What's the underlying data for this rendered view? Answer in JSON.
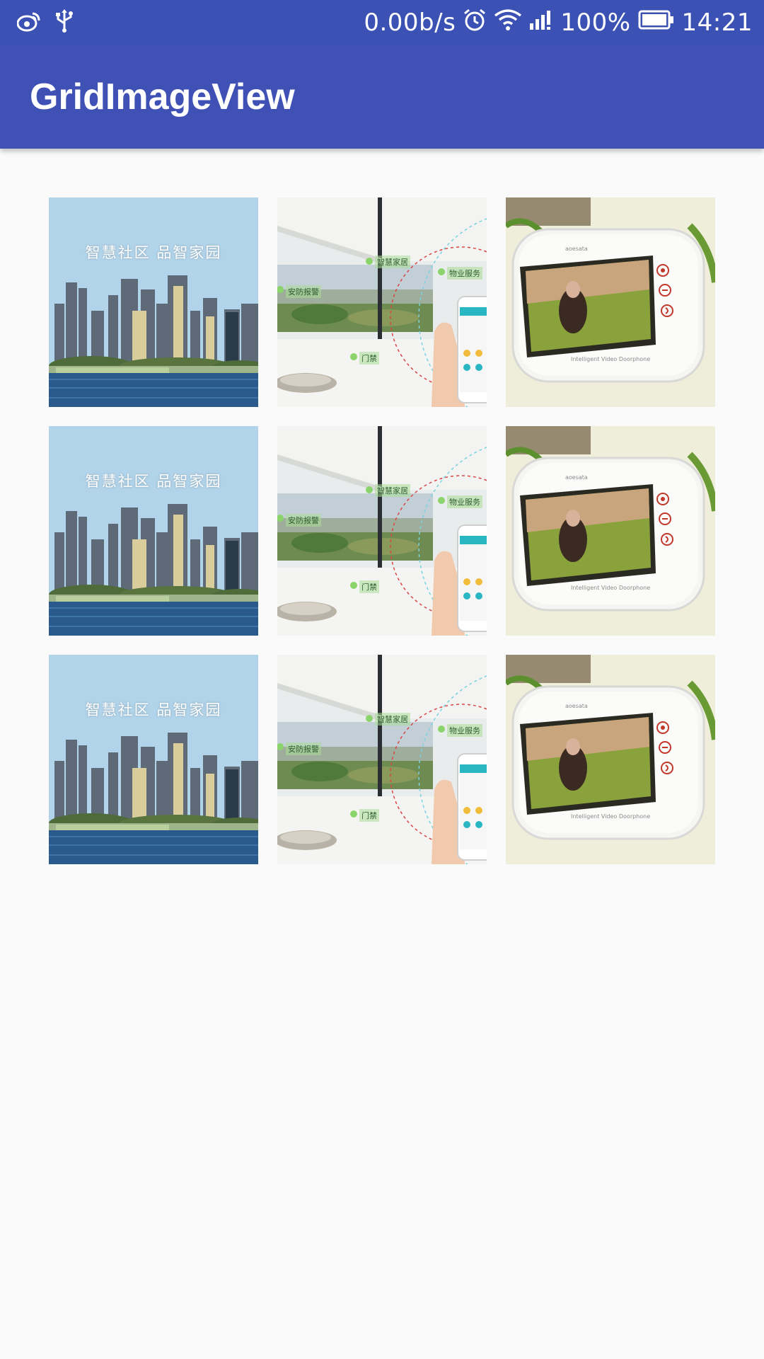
{
  "status_bar": {
    "icons_left": [
      "weibo-icon",
      "usb-icon"
    ],
    "network_speed": "0.00b/s",
    "icons_right": [
      "alarm-icon",
      "wifi-icon",
      "signal-icon"
    ],
    "battery": "100%",
    "time": "14:21"
  },
  "app_bar": {
    "title": "GridImageView"
  },
  "grid": {
    "columns": 3,
    "rows": 3,
    "city": {
      "caption": "智慧社区  品智家园"
    },
    "smart_home": {
      "tag_1": "智慧家居",
      "tag_2": "物业服务",
      "tag_3": "安防报警",
      "tag_4": "门禁"
    },
    "intercom": {
      "brand": "aoesata",
      "model": "Intelligent Video Doorphone"
    }
  }
}
